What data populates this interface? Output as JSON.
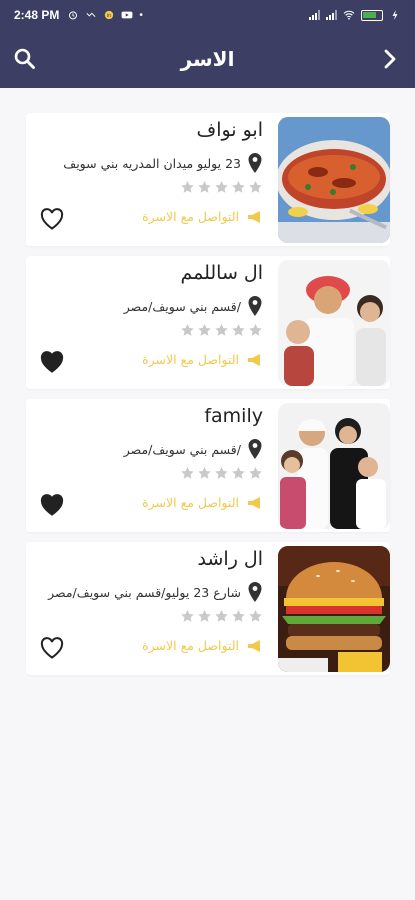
{
  "status_bar": {
    "time": "2:48 PM",
    "battery_color": "#4caf50"
  },
  "header": {
    "title": "الاسر",
    "background": "#3c3f63",
    "search_icon": "search-icon",
    "back_icon": "chevron-right-icon"
  },
  "accent_color": "#f2c94c",
  "families": [
    {
      "name": "ابو نواف",
      "address": "23 يوليو ميدان المدريه بني سويف",
      "rating": 0,
      "contact_label": "التواصل مع الاسرة",
      "favorited": false,
      "image": "grilled-fish-photo"
    },
    {
      "name": "ال ساللمم",
      "address": "/قسم بني سويف/مصر",
      "rating": 0,
      "contact_label": "التواصل مع الاسرة",
      "favorited": true,
      "image": "family-photo"
    },
    {
      "name": "family",
      "address": "/قسم بني سويف/مصر",
      "rating": 0,
      "contact_label": "التواصل مع الاسرة",
      "favorited": true,
      "image": "family-photo-2"
    },
    {
      "name": "ال راشد",
      "address": "شارع 23 يوليو/قسم بني سويف/مصر",
      "rating": 0,
      "contact_label": "التواصل مع الاسرة",
      "favorited": false,
      "image": "burger-photo"
    }
  ]
}
